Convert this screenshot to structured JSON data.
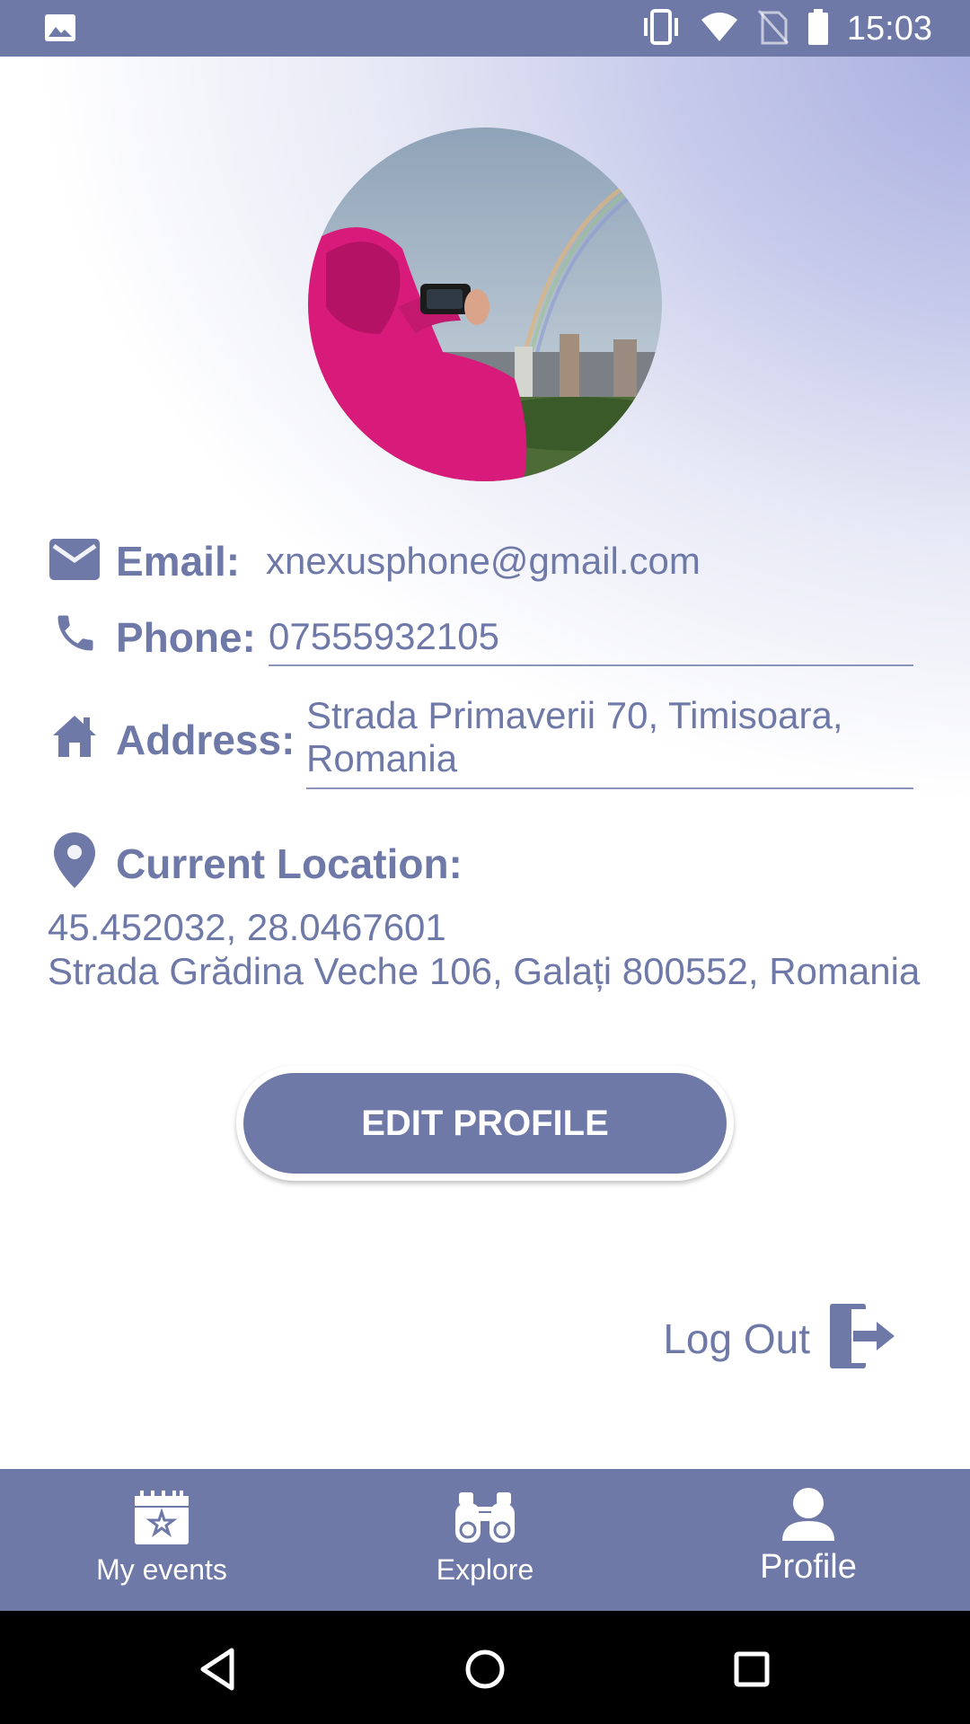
{
  "status_bar": {
    "time": "15:03",
    "icons": [
      "image-icon",
      "vibrate-icon",
      "wifi-icon",
      "no-sim-icon",
      "battery-icon"
    ]
  },
  "profile": {
    "email_label": "Email:",
    "email_value": "xnexusphone@gmail.com",
    "phone_label": "Phone:",
    "phone_value": "07555932105",
    "address_label": "Address:",
    "address_line1": "Strada Primaverii 70, Timisoara,",
    "address_line2": "Romania",
    "location_label": "Current Location:",
    "location_coords": "45.452032, 28.0467601",
    "location_address": "Strada Grădina Veche 106, Galați 800552, Romania"
  },
  "actions": {
    "edit_profile": "EDIT PROFILE",
    "log_out": "Log Out"
  },
  "bottom_nav": {
    "items": [
      {
        "label": "My events",
        "icon": "calendar-star-icon"
      },
      {
        "label": "Explore",
        "icon": "binoculars-icon"
      },
      {
        "label": "Profile",
        "icon": "person-icon",
        "active": true
      }
    ]
  },
  "colors": {
    "accent": "#6e79a8",
    "background_top": "#a4aade",
    "white": "#ffffff"
  }
}
